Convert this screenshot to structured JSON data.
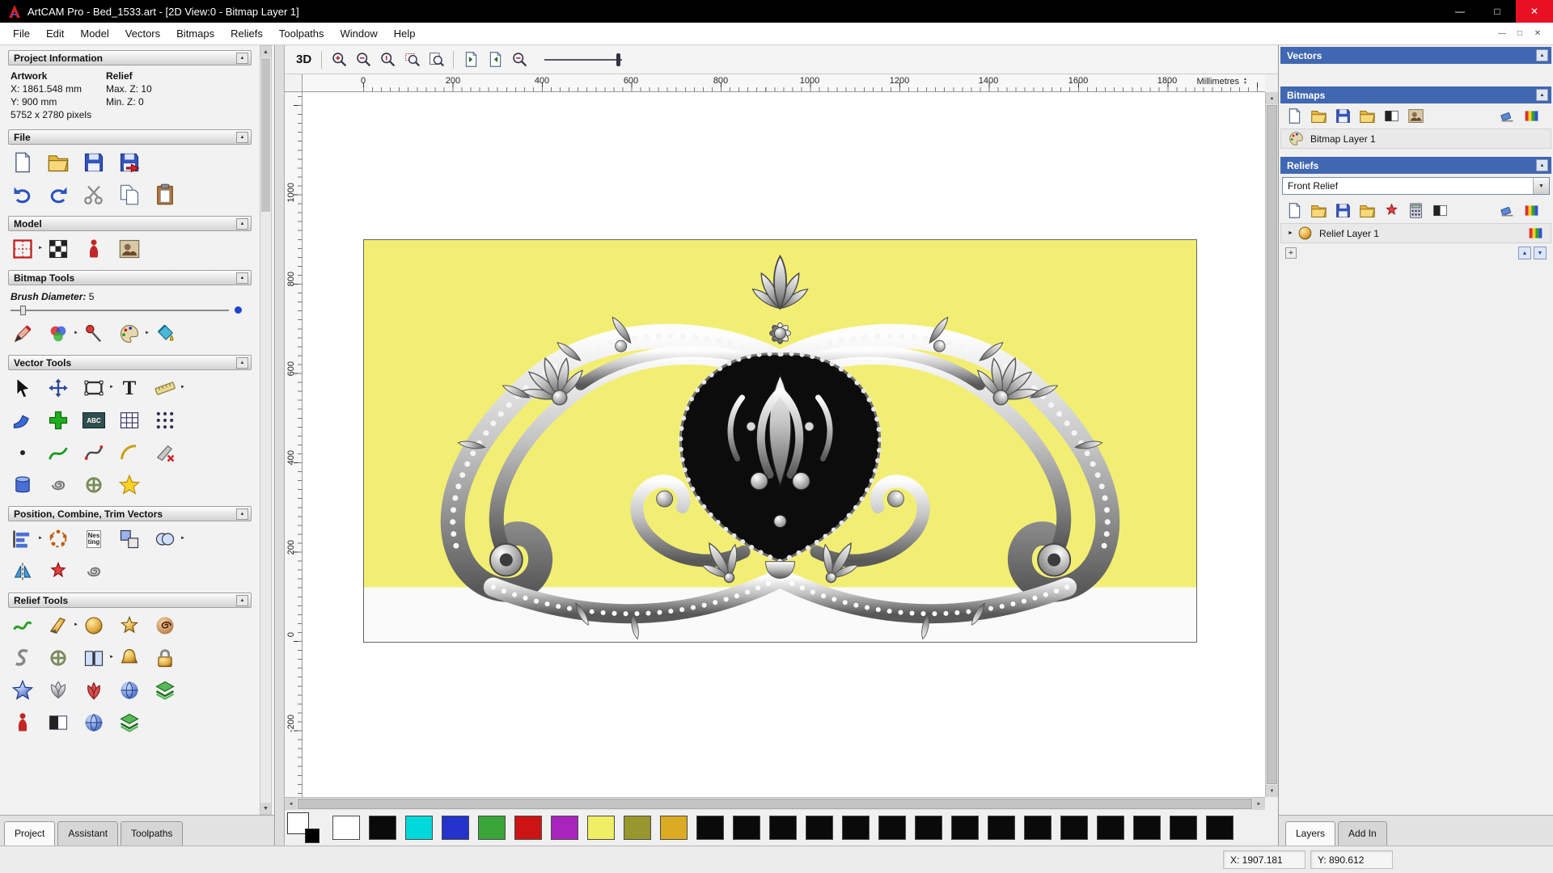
{
  "window": {
    "title": "ArtCAM Pro - Bed_1533.art - [2D View:0 - Bitmap Layer 1]"
  },
  "menu": {
    "items": [
      "File",
      "Edit",
      "Model",
      "Vectors",
      "Bitmaps",
      "Reliefs",
      "Toolpaths",
      "Window",
      "Help"
    ]
  },
  "colors": {
    "header_blue": "#4067b1",
    "close_red": "#e81123",
    "canvas_yellow": "#f2ee73"
  },
  "icons": {
    "minimize": "—",
    "maximize": "□",
    "close": "✕",
    "collapse": "▲",
    "dropdown": "▼",
    "flyout": "►",
    "expander": "►",
    "scroll_up": "▲",
    "scroll_down": "▼",
    "scroll_left": "◄",
    "scroll_right": "►",
    "move_up": "▲",
    "move_down": "▼",
    "add": "+",
    "text_tool": "T",
    "abc_label": "ABC",
    "nesting_line1": "Nes",
    "nesting_line2": "ting"
  },
  "left_panel": {
    "project_information": {
      "title": "Project Information",
      "artwork_heading": "Artwork",
      "relief_heading": "Relief",
      "x": "X: 1861.548 mm",
      "y": "Y: 900 mm",
      "pixels": "5752 x 2780 pixels",
      "max_z": "Max. Z: 10",
      "min_z": "Min. Z: 0"
    },
    "file": {
      "title": "File"
    },
    "model": {
      "title": "Model"
    },
    "bitmap_tools": {
      "title": "Bitmap Tools",
      "brush_diameter_label": "Brush Diameter:",
      "brush_diameter_value": "5"
    },
    "vector_tools": {
      "title": "Vector Tools"
    },
    "position": {
      "title": "Position, Combine, Trim Vectors"
    },
    "relief_tools": {
      "title": "Relief Tools"
    },
    "tabs": [
      "Project",
      "Assistant",
      "Toolpaths"
    ]
  },
  "canvas": {
    "toolbar": {
      "threed": "3D"
    },
    "ruler": {
      "units": "Millimetres",
      "h": [
        "0",
        "200",
        "400",
        "600",
        "800",
        "1000",
        "1200",
        "1400",
        "1600",
        "1800"
      ],
      "v": [
        "1000",
        "800",
        "600",
        "400",
        "200",
        "0",
        "-200"
      ]
    }
  },
  "right_panel": {
    "vectors": {
      "title": "Vectors"
    },
    "bitmaps": {
      "title": "Bitmaps",
      "layer": "Bitmap Layer 1"
    },
    "reliefs": {
      "title": "Reliefs",
      "combo": "Front Relief",
      "layer": "Relief Layer 1"
    },
    "tabs": [
      "Layers",
      "Add In"
    ]
  },
  "palette": {
    "primary": "#ffffff",
    "secondary": "#000000",
    "colors": [
      "#ffffff",
      "#0a0a0a",
      "#00d9d9",
      "#2333cc",
      "#3aa63a",
      "#cc1414",
      "#a824bc",
      "#efee64",
      "#97972e",
      "#dcab24",
      "#0a0a0a",
      "#0a0a0a",
      "#0a0a0a",
      "#0a0a0a",
      "#0a0a0a",
      "#0a0a0a",
      "#0a0a0a",
      "#0a0a0a",
      "#0a0a0a",
      "#0a0a0a",
      "#0a0a0a",
      "#0a0a0a",
      "#0a0a0a",
      "#0a0a0a",
      "#0a0a0a"
    ]
  },
  "status_bar": {
    "x": "X: 1907.181",
    "y": "Y: 890.612"
  }
}
